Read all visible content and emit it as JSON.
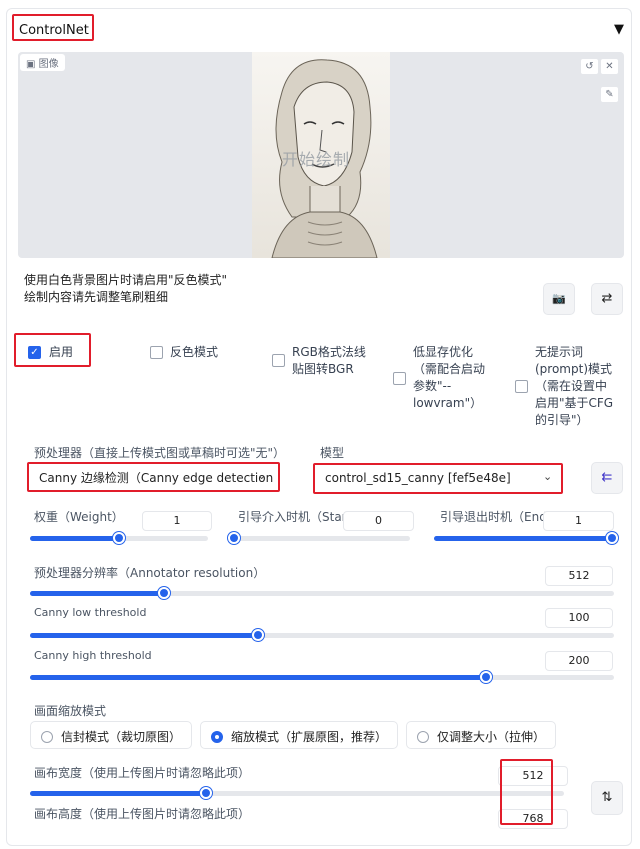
{
  "panel": {
    "title": "ControlNet",
    "collapse_icon": "▼"
  },
  "image": {
    "label": "图像",
    "watermark": "开始绘制"
  },
  "hint": {
    "line1": "使用白色背景图片时请启用\"反色模式\"",
    "line2": "绘制内容请先调整笔刷粗细"
  },
  "options": {
    "enable": {
      "label": "启用",
      "checked": true
    },
    "invert": {
      "label": "反色模式",
      "checked": false
    },
    "rgb_bgr": {
      "line1": "RGB格式法线",
      "line2": "贴图转BGR",
      "checked": false
    },
    "lowvram": {
      "line1": "低显存优化",
      "line2": "（需配合启动",
      "line3": "参数\"--",
      "line4": "lowvram\"）",
      "checked": false
    },
    "guess": {
      "line1": "无提示词",
      "line2": "(prompt)模式",
      "line3": "（需在设置中",
      "line4": "启用\"基于CFG",
      "line5": "的引导\"）",
      "checked": false
    }
  },
  "preprocessor": {
    "label": "预处理器（直接上传模式图或草稿时可选\"无\"）",
    "value": "Canny 边缘检测（Canny edge detection"
  },
  "model": {
    "label": "模型",
    "value": "control_sd15_canny [fef5e48e]"
  },
  "weight": {
    "label": "权重（Weight）",
    "value": "1",
    "fraction": 0.5
  },
  "guidance_start": {
    "label": "引导介入时机（Start）",
    "value": "0",
    "fraction": 0.0
  },
  "guidance_end": {
    "label": "引导退出时机（End）",
    "value": "1",
    "fraction": 1.0
  },
  "annotator_res": {
    "label": "预处理器分辨率（Annotator resolution）",
    "value": "512",
    "fraction": 0.23
  },
  "low_threshold": {
    "label": "Canny low threshold",
    "value": "100",
    "fraction": 0.39
  },
  "high_threshold": {
    "label": "Canny high threshold",
    "value": "200",
    "fraction": 0.78
  },
  "resize_mode": {
    "label": "画面缩放模式",
    "options": [
      {
        "label": "信封模式（裁切原图）",
        "selected": false
      },
      {
        "label": "缩放模式（扩展原图，推荐）",
        "selected": true
      },
      {
        "label": "仅调整大小（拉伸）",
        "selected": false
      }
    ]
  },
  "canvas_width": {
    "label": "画布宽度（使用上传图片时请忽略此项）",
    "value": "512",
    "fraction": 0.33
  },
  "canvas_height": {
    "label": "画布高度（使用上传图片时请忽略此项）",
    "value": "768"
  },
  "icons": {
    "refresh": "↺",
    "close": "✕",
    "brush": "✎",
    "camera": "📷",
    "swap": "⇄",
    "end": "⇇",
    "swap_vertical": "⇅",
    "check": "✓",
    "chevron": "⌄"
  },
  "colors": {
    "accent": "#2563eb",
    "highlight": "#e11d2b"
  }
}
